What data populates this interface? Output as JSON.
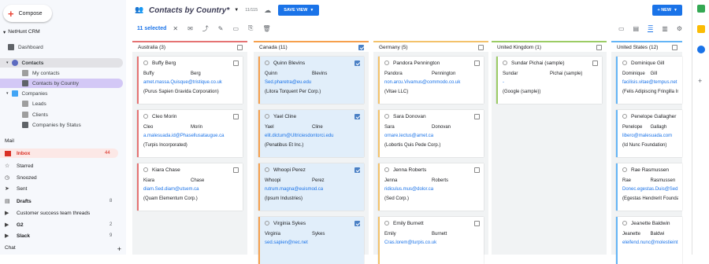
{
  "app": {
    "compose": "Compose",
    "nethunt": "NetHunt CRM"
  },
  "sidebar": {
    "dashboard": "Dashboard",
    "contacts": "Contacts",
    "my_contacts": "My contacts",
    "contacts_by_country": "Contacts by Country",
    "companies": "Companies",
    "leads": "Leads",
    "clients": "Clients",
    "companies_by_status": "Companies by Status"
  },
  "mail": {
    "section": "Mail",
    "items": [
      {
        "label": "Inbox",
        "count": "44"
      },
      {
        "label": "Starred",
        "count": ""
      },
      {
        "label": "Snoozed",
        "count": ""
      },
      {
        "label": "Sent",
        "count": ""
      },
      {
        "label": "Drafts",
        "count": "8"
      },
      {
        "label": "Customer success team threads",
        "count": ""
      },
      {
        "label": "G2",
        "count": "2"
      },
      {
        "label": "Slack",
        "count": "9"
      }
    ],
    "chat": "Chat"
  },
  "view": {
    "title": "Contacts by Country*",
    "count": "11/115",
    "save_label": "SAVE VIEW",
    "new_label": "+ NEW",
    "selected": "11 selected"
  },
  "columns": [
    {
      "name": "Australia",
      "count": "(3)",
      "color": "#e57373",
      "checked": false
    },
    {
      "name": "Canada",
      "count": "(11)",
      "color": "#f6a04d",
      "checked": true
    },
    {
      "name": "Germany",
      "count": "(5)",
      "color": "#f3c26b",
      "checked": false
    },
    {
      "name": "United Kingdom",
      "count": "(1)",
      "color": "#9ccc65",
      "checked": false
    },
    {
      "name": "United States",
      "count": "(12)",
      "color": "#64b5f6",
      "checked": false
    }
  ],
  "cards": [
    [
      {
        "name": "Buffy Berg",
        "first": "Buffy",
        "last": "Berg",
        "email": "amet.massa.Quisque@tristique.co.uk",
        "company": "(Purus Sapien Gravida Corporation)",
        "selected": false
      },
      {
        "name": "Cleo Morin",
        "first": "Cleo",
        "last": "Morin",
        "email": "a.malesuada.id@Phasellusataugue.ca",
        "company": "(Turpis Incorporated)",
        "selected": false
      },
      {
        "name": "Kiara Chase",
        "first": "Kiara",
        "last": "Chase",
        "email": "diam.Sed.diam@utsem.ca",
        "company": "(Quam Elementum Corp.)",
        "selected": false
      }
    ],
    [
      {
        "name": "Quinn Blevins",
        "first": "Quinn",
        "last": "Blevins",
        "email": "Sed.pharetra@eu.edu",
        "company": "(Litora Torquent Per Corp.)",
        "selected": true
      },
      {
        "name": "Yael Cline",
        "first": "Yael",
        "last": "Cline",
        "email": "elit.dictum@Ultriciesdontorci.edu",
        "company": "(Penatibus Et Inc.)",
        "selected": true
      },
      {
        "name": "Whoopi Perez",
        "first": "Whoopi",
        "last": "Perez",
        "email": "rutrum.magna@euismod.ca",
        "company": "(Ipsum Industries)",
        "selected": true
      },
      {
        "name": "Virginia Sykes",
        "first": "Virginia",
        "last": "Sykes",
        "email": "sed.sapien@nec.net",
        "company": "",
        "selected": true
      }
    ],
    [
      {
        "name": "Pandora Pennington",
        "first": "Pandora",
        "last": "Pennington",
        "email": "non.arcu.Vivamus@commodo.co.uk",
        "company": "(Vitae LLC)",
        "selected": false
      },
      {
        "name": "Sara Donovan",
        "first": "Sara",
        "last": "Donovan",
        "email": "ornare.lectus@amet.ca",
        "company": "(Lobortis Quis Pede Corp.)",
        "selected": false
      },
      {
        "name": "Jenna Roberts",
        "first": "Jenna",
        "last": "Roberts",
        "email": "ridiculus.mus@dolor.ca",
        "company": "(Sed Corp.)",
        "selected": false
      },
      {
        "name": "Emily Burnett",
        "first": "Emily",
        "last": "Burnett",
        "email": "Cras.lorem@turpis.co.uk",
        "company": "",
        "selected": false
      }
    ],
    [
      {
        "name": "Sundar Pichai (sample)",
        "first": "Sundar",
        "last": "Pichai (sample)",
        "email": "-",
        "company": "(Google (sample))",
        "selected": false
      }
    ],
    [
      {
        "name": "Dominique Gill",
        "first": "Dominique",
        "last": "Gill",
        "email": "facilisis.vitae@tempus.net",
        "company": "(Felis Adipiscing Fringilla In",
        "selected": false
      },
      {
        "name": "Penelope Gallagher",
        "first": "Penelope",
        "last": "Gallagh",
        "email": "libero@malesuada.com",
        "company": "(Id Nunc Foundation)",
        "selected": false
      },
      {
        "name": "Rae Rasmussen",
        "first": "Rae",
        "last": "Rasmussen",
        "email": "Donec.egestas.Duis@Sed.e",
        "company": "(Egestas Hendrerit Foundation",
        "selected": false
      },
      {
        "name": "Jeanette Baldwin",
        "first": "Jeanette",
        "last": "Baldwi",
        "email": "eleifend.nunc@molestieint",
        "company": "",
        "selected": false
      }
    ]
  ]
}
